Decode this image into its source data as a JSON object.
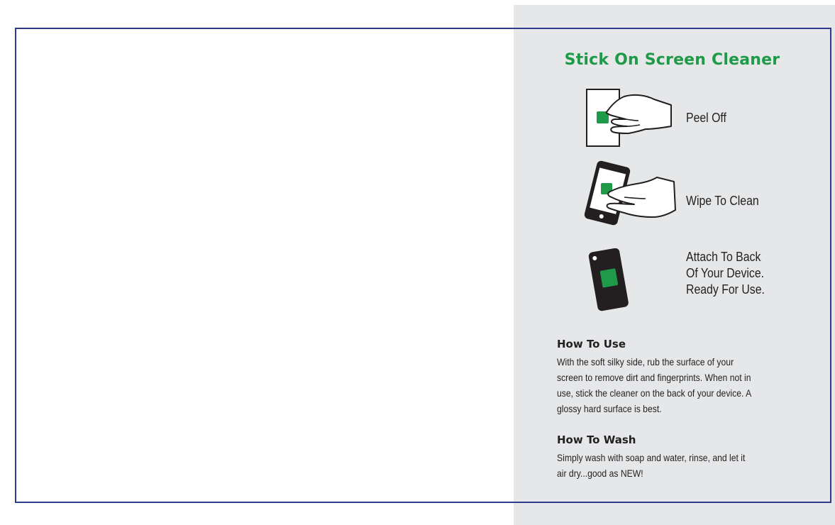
{
  "panel": {
    "title": "Stick On Screen Cleaner",
    "accent_color": "#1f9a48",
    "frame_color": "#2e3a8c",
    "steps": [
      {
        "icon": "peel-off-hand-icon",
        "label": "Peel Off"
      },
      {
        "icon": "wipe-phone-icon",
        "label": "Wipe To Clean"
      },
      {
        "icon": "phone-back-icon",
        "label_lines": [
          "Attach To Back",
          "Of Your Device.",
          "Ready For Use."
        ]
      }
    ],
    "how_to_use": {
      "heading": "How To Use",
      "lines": [
        "With the soft silky side, rub the surface of your",
        "screen to remove dirt and fingerprints. When not in",
        "use, stick the cleaner on the back of your device. A",
        "glossy hard surface is best."
      ]
    },
    "how_to_wash": {
      "heading": "How To Wash",
      "lines": [
        "Simply wash with soap and water, rinse, and let it",
        "air dry...good as NEW!"
      ]
    }
  }
}
